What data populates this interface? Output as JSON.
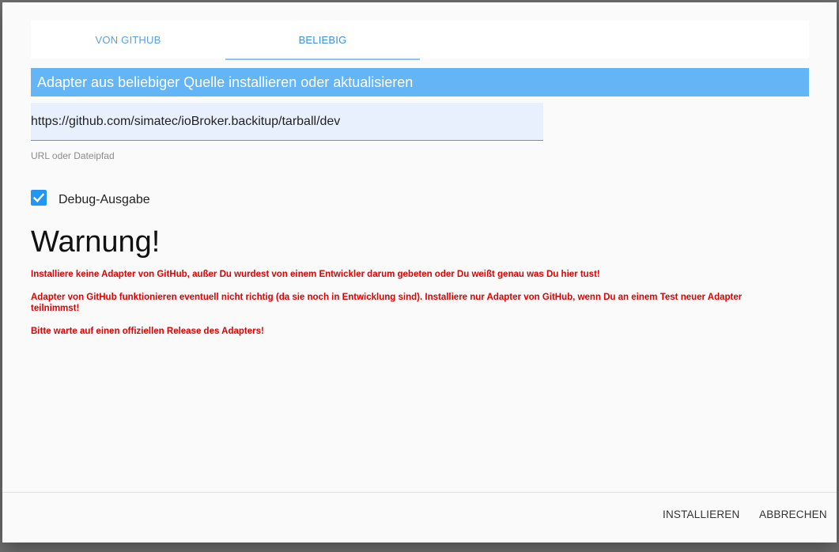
{
  "tabs": [
    {
      "label": "VON GITHUB",
      "active": false
    },
    {
      "label": "BELIEBIG",
      "active": true
    }
  ],
  "section": {
    "header": "Adapter aus beliebiger Quelle installieren oder aktualisieren"
  },
  "url_input": {
    "value": "https://github.com/simatec/ioBroker.backitup/tarball/dev",
    "helper": "URL oder Dateipfad"
  },
  "debug": {
    "label": "Debug-Ausgabe",
    "checked": true
  },
  "warning": {
    "title": "Warnung!",
    "lines": [
      "Installiere keine Adapter von GitHub, außer Du wurdest von einem Entwickler darum gebeten oder Du weißt genau was Du hier tust!",
      "Adapter von GitHub funktionieren eventuell nicht richtig (da sie noch in Entwicklung sind). Installiere nur Adapter von GitHub, wenn Du an einem Test neuer Adapter teilnimmst!",
      "Bitte warte auf einen offiziellen Release des Adapters!"
    ],
    "color": "#e00000"
  },
  "actions": {
    "install_label": "INSTALLIEREN",
    "cancel_label": "ABBRECHEN"
  },
  "colors": {
    "accent": "#2196f3",
    "header_bg": "#64b5f6",
    "input_bg": "#e8f0fe"
  },
  "icons": {
    "checkbox": "check-icon"
  }
}
